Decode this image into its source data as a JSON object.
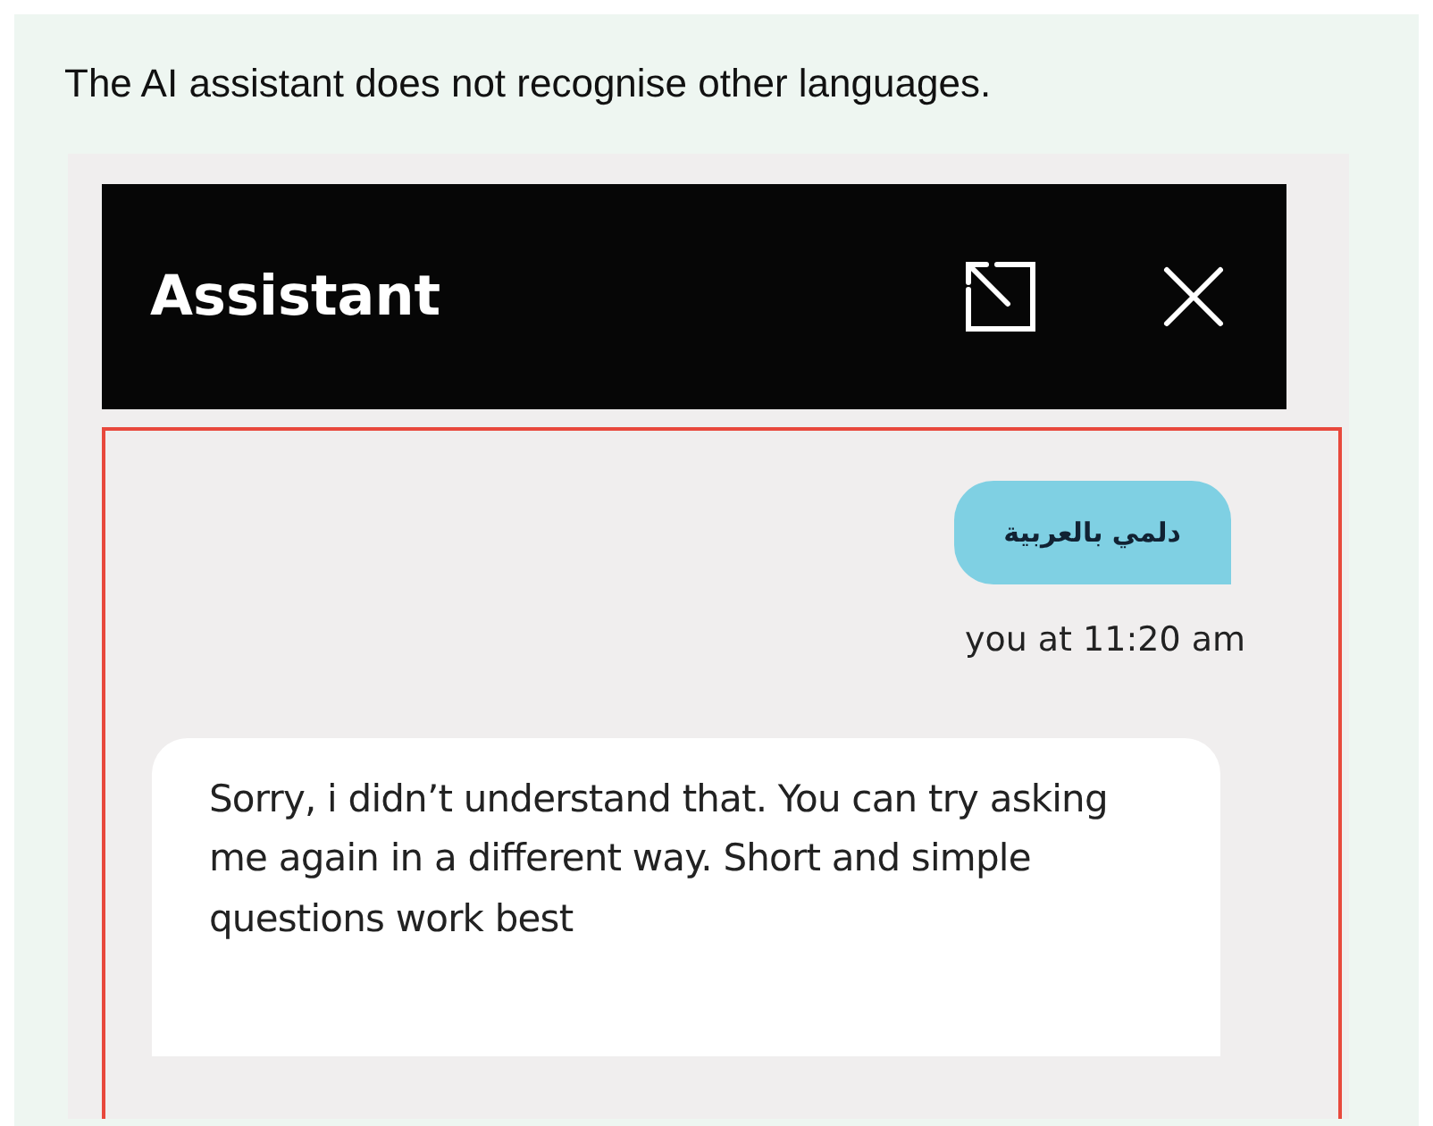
{
  "caption": "The AI assistant does not recognise other languages.",
  "assistant": {
    "title": "Assistant",
    "messages": [
      {
        "kind": "user",
        "text": "دلمي بالعربية",
        "meta": "you at 11:20 am"
      },
      {
        "kind": "bot",
        "text": "Sorry, i didn’t understand that. You can try asking me again in a different way. Short and simple questions work best"
      }
    ]
  }
}
